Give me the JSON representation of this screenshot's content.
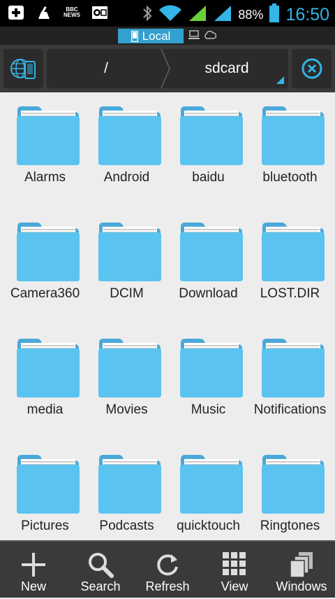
{
  "status_bar": {
    "battery_percent": "88%",
    "time": "16:50",
    "news_icon_text": "BBC NEWS",
    "icons": [
      "add-icon",
      "cleaner-icon",
      "bbc-news-icon",
      "outlook-icon",
      "bluetooth-icon",
      "wifi-icon",
      "signal-icon",
      "signal-icon",
      "battery-icon"
    ]
  },
  "tabs": {
    "active_label": "Local"
  },
  "path": {
    "root": "/",
    "current": "sdcard"
  },
  "folders": [
    {
      "name": "Alarms"
    },
    {
      "name": "Android"
    },
    {
      "name": "baidu"
    },
    {
      "name": "bluetooth"
    },
    {
      "name": "Camera360"
    },
    {
      "name": "DCIM"
    },
    {
      "name": "Download"
    },
    {
      "name": "LOST.DIR"
    },
    {
      "name": "media"
    },
    {
      "name": "Movies"
    },
    {
      "name": "Music"
    },
    {
      "name": "Notifications"
    },
    {
      "name": "Pictures"
    },
    {
      "name": "Podcasts"
    },
    {
      "name": "quicktouch"
    },
    {
      "name": "Ringtones"
    }
  ],
  "bottom_bar": {
    "new": "New",
    "search": "Search",
    "refresh": "Refresh",
    "view": "View",
    "windows": "Windows"
  },
  "colors": {
    "accent": "#33b5e5",
    "folder": "#5bc3f0",
    "background": "#ededed"
  }
}
